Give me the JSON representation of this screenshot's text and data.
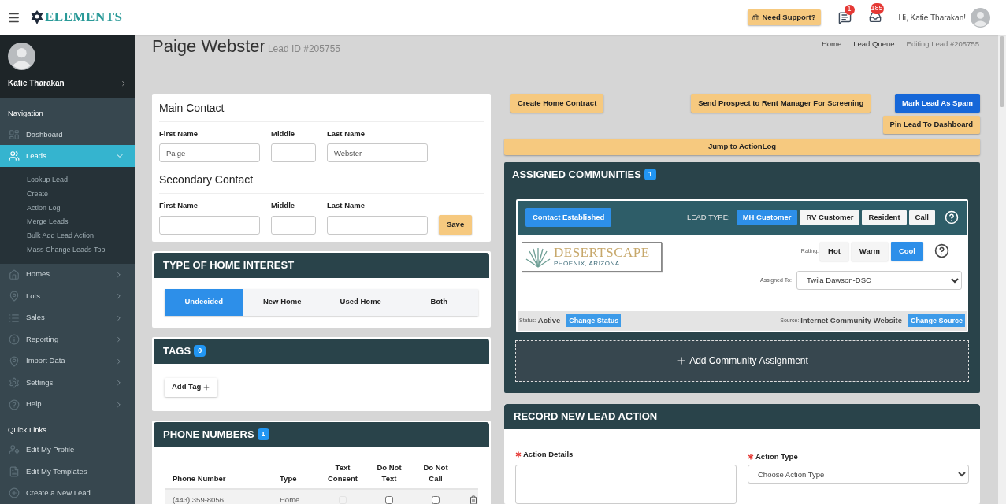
{
  "header": {
    "logo_text": "ELEMENTS",
    "support_button": "Need Support?",
    "messages_count": "1",
    "notifications_count": "185",
    "greeting": "Hi, Katie Tharakan!"
  },
  "sidebar": {
    "user_name": "Katie Tharakan",
    "nav_heading": "Navigation",
    "items": [
      {
        "label": "Dashboard",
        "kind": "link",
        "selected": false
      },
      {
        "label": "Leads",
        "kind": "group",
        "selected": true,
        "expanded": true,
        "children": [
          {
            "label": "Lookup Lead"
          },
          {
            "label": "Create"
          },
          {
            "label": "Action Log"
          },
          {
            "label": "Merge Leads"
          },
          {
            "label": "Bulk Add Lead Action"
          },
          {
            "label": "Mass Change Leads Tool"
          }
        ]
      },
      {
        "label": "Homes",
        "kind": "group",
        "selected": false,
        "expanded": false
      },
      {
        "label": "Lots",
        "kind": "group",
        "selected": false,
        "expanded": false
      },
      {
        "label": "Sales",
        "kind": "group",
        "selected": false,
        "expanded": false
      },
      {
        "label": "Reporting",
        "kind": "group",
        "selected": false,
        "expanded": false
      },
      {
        "label": "Import Data",
        "kind": "group",
        "selected": false,
        "expanded": false
      },
      {
        "label": "Settings",
        "kind": "group",
        "selected": false,
        "expanded": false
      },
      {
        "label": "Help",
        "kind": "group",
        "selected": false,
        "expanded": false
      }
    ],
    "quick_links_heading": "Quick Links",
    "quick_links": [
      {
        "label": "Edit My Profile"
      },
      {
        "label": "Edit My Templates"
      },
      {
        "label": "Create a New Lead"
      }
    ]
  },
  "page": {
    "title": "Paige Webster",
    "subtitle": "Lead ID #205755",
    "breadcrumbs": [
      {
        "label": "Home",
        "current": false
      },
      {
        "label": "Lead Queue",
        "current": false
      },
      {
        "label": "Editing Lead #205755",
        "current": true
      }
    ]
  },
  "main_contact": {
    "title": "Main Contact",
    "fields": [
      {
        "label": "First Name",
        "value": "Paige"
      },
      {
        "label": "Middle"
      },
      {
        "label": "Last Name",
        "value": "Webster"
      }
    ]
  },
  "secondary_contact": {
    "title": "Secondary Contact",
    "fields": [
      {
        "label": "First Name"
      },
      {
        "label": "Middle"
      },
      {
        "label": "Last Name"
      }
    ],
    "save_button": "Save"
  },
  "home_interest": {
    "title": "TYPE OF HOME INTEREST",
    "options": [
      {
        "label": "Undecided",
        "selected": true
      },
      {
        "label": "New Home",
        "selected": false
      },
      {
        "label": "Used Home",
        "selected": false
      },
      {
        "label": "Both",
        "selected": false
      }
    ]
  },
  "tags": {
    "title": "TAGS",
    "count": "0",
    "add_button": "Add Tag"
  },
  "phone_numbers": {
    "title": "PHONE NUMBERS",
    "count": "1",
    "columns": [
      "Phone Number",
      "Type",
      "Text Consent",
      "Do Not Text",
      "Do Not Call"
    ],
    "rows": [
      {
        "number": "(443) 359-8056",
        "type": "Home",
        "text_consent": {
          "checked": false,
          "disabled": true
        },
        "do_not_text": {
          "checked": false,
          "disabled": false
        },
        "do_not_call": {
          "checked": false,
          "disabled": false
        }
      }
    ]
  },
  "action_buttons": {
    "create_contract": "Create Home Contract",
    "send_prospect": "Send Prospect to Rent Manager For Screening",
    "mark_spam": "Mark Lead As Spam",
    "pin_lead": "Pin Lead To Dashboard",
    "jump": "Jump to ActionLog"
  },
  "assigned_communities": {
    "title": "ASSIGNED COMMUNITIES",
    "count": "1",
    "community": {
      "status_button": "Contact Established",
      "lead_type_label": "LEAD TYPE:",
      "lead_types": [
        {
          "label": "MH Customer",
          "selected": true
        },
        {
          "label": "RV Customer",
          "selected": false
        },
        {
          "label": "Resident",
          "selected": false
        },
        {
          "label": "Call",
          "selected": false
        }
      ],
      "logo_name": "DESERTSCAPE",
      "logo_place": "PHOENIX, ARIZONA",
      "rating_label": "Rating:",
      "ratings": [
        {
          "label": "Hot",
          "selected": false
        },
        {
          "label": "Warm",
          "selected": false
        },
        {
          "label": "Cool",
          "selected": true
        }
      ],
      "assigned_to_label": "Assigned To:",
      "assigned_to": "Twila Dawson-DSC",
      "status_label": "Status:",
      "status": "Active",
      "change_status": "Change Status",
      "source_label": "Source:",
      "source": "Internet Community Website",
      "change_source": "Change Source"
    },
    "add_assignment": "Add Community Assignment"
  },
  "record_action": {
    "title": "RECORD NEW LEAD ACTION",
    "details_label": "Action Details",
    "type_label": "Action Type",
    "type_placeholder": "Choose Action Type"
  }
}
